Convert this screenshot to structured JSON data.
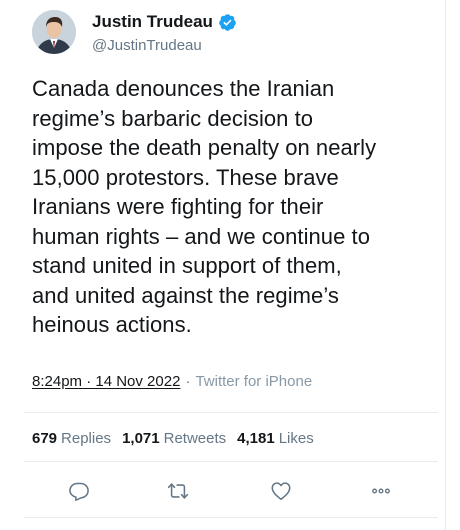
{
  "author": {
    "display_name": "Justin Trudeau",
    "handle": "@JustinTrudeau",
    "verified": true,
    "avatar_icon": "profile-photo"
  },
  "tweet": {
    "text": "Canada denounces the Iranian\nregime’s barbaric decision to\nimpose the death penalty on nearly\n15,000 protestors. These brave\nIranians were fighting for their\nhuman rights – and we continue to\nstand united in support of them,\nand united against the regime’s\nheinous actions."
  },
  "meta": {
    "timestamp": "8:24pm · 14 Nov 2022",
    "separator": "·",
    "source": "Twitter for iPhone"
  },
  "stats": {
    "replies_count": "679",
    "replies_label": "Replies",
    "retweets_count": "1,071",
    "retweets_label": "Retweets",
    "likes_count": "4,181",
    "likes_label": "Likes"
  },
  "actions": [
    {
      "name": "reply",
      "icon": "reply-icon"
    },
    {
      "name": "retweet",
      "icon": "retweet-icon"
    },
    {
      "name": "like",
      "icon": "heart-icon"
    },
    {
      "name": "more",
      "icon": "more-icon"
    }
  ],
  "colors": {
    "primary_text": "#14171a",
    "secondary_text": "#657786",
    "verified_blue": "#1da1f2",
    "divider": "#e6ecf0"
  }
}
